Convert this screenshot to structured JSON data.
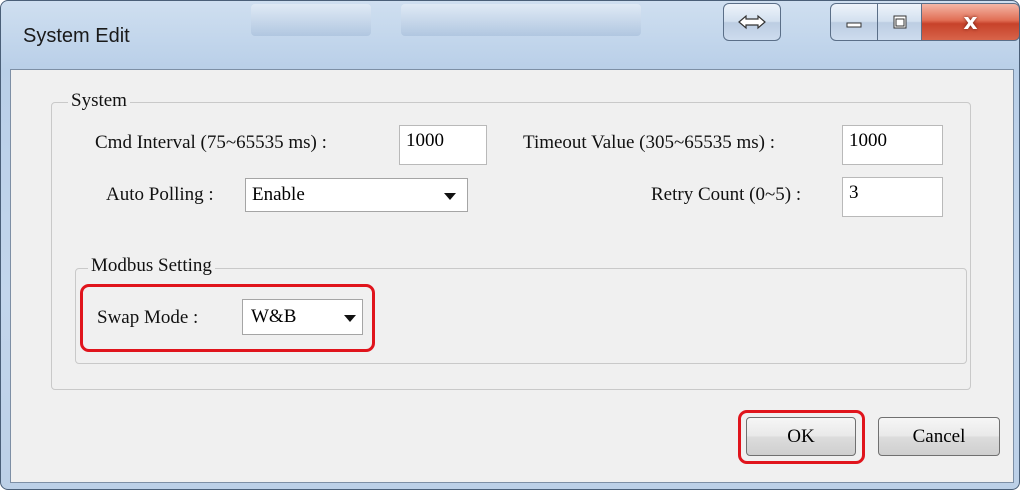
{
  "window": {
    "title": "System Edit",
    "resize_icon": "double-arrow-icon",
    "minimize_icon": "minimize-icon",
    "maximize_icon": "maximize-icon",
    "close_glyph": "x",
    "colors": {
      "highlight": "#e0141c",
      "close": "#c7422a"
    }
  },
  "system": {
    "group_label": "System",
    "cmd_interval_label": "Cmd Interval (75~65535 ms) :",
    "cmd_interval_value": "1000",
    "timeout_label": "Timeout Value (305~65535 ms) :",
    "timeout_value": "1000",
    "auto_polling_label": "Auto Polling :",
    "auto_polling_value": "Enable",
    "retry_label": "Retry Count (0~5) :",
    "retry_value": "3"
  },
  "modbus": {
    "group_label": "Modbus Setting",
    "swap_mode_label": "Swap Mode :",
    "swap_mode_value": "W&B"
  },
  "buttons": {
    "ok": "OK",
    "cancel": "Cancel"
  }
}
